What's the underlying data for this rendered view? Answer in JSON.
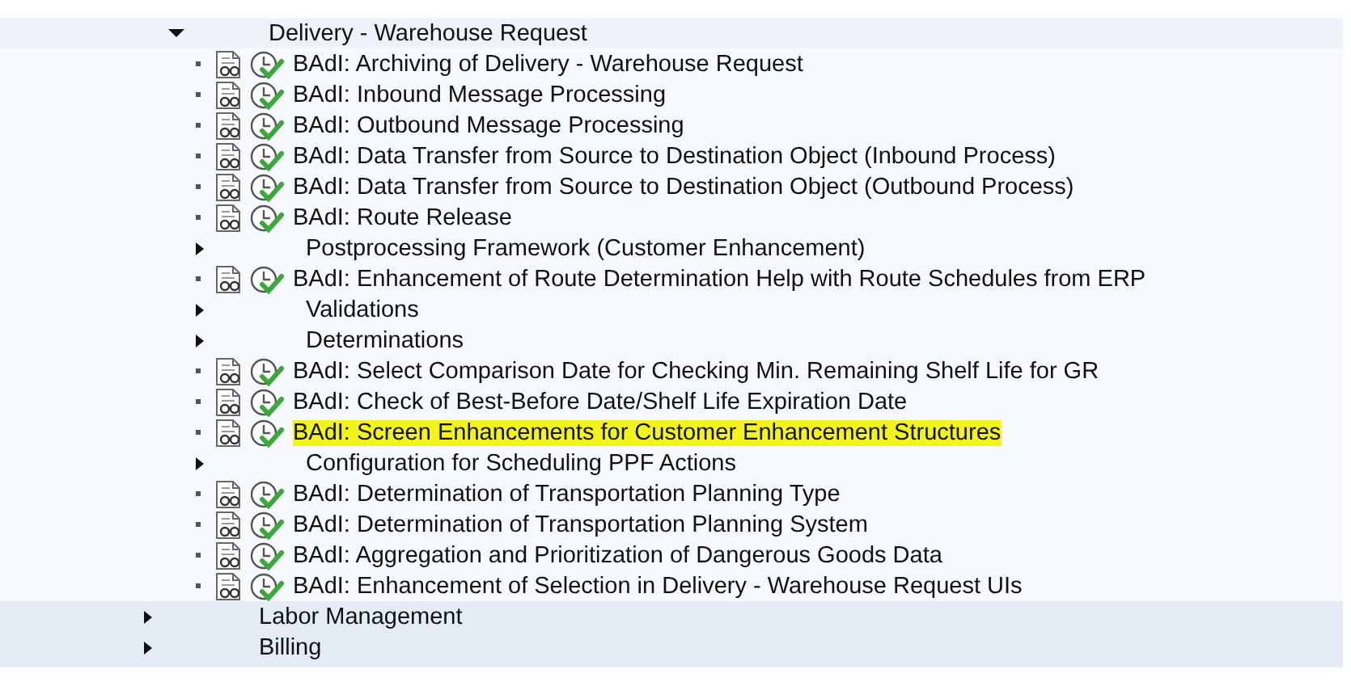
{
  "tree": {
    "expanded_node": {
      "label": "Delivery - Warehouse Request",
      "expanded": true,
      "children": [
        {
          "kind": "badi",
          "label": "BAdI: Archiving of Delivery - Warehouse Request",
          "highlighted": false
        },
        {
          "kind": "badi",
          "label": "BAdI: Inbound Message Processing",
          "highlighted": false
        },
        {
          "kind": "badi",
          "label": "BAdI: Outbound Message Processing",
          "highlighted": false
        },
        {
          "kind": "badi",
          "label": "BAdI: Data Transfer from Source to Destination Object (Inbound Process)",
          "highlighted": false
        },
        {
          "kind": "badi",
          "label": "BAdI: Data Transfer from Source to Destination Object (Outbound Process)",
          "highlighted": false
        },
        {
          "kind": "badi",
          "label": "BAdI: Route Release",
          "highlighted": false
        },
        {
          "kind": "folder",
          "label": "Postprocessing Framework (Customer Enhancement)",
          "expanded": false
        },
        {
          "kind": "badi",
          "label": "BAdI: Enhancement of Route Determination Help with Route Schedules from ERP",
          "highlighted": false
        },
        {
          "kind": "folder",
          "label": "Validations",
          "expanded": false
        },
        {
          "kind": "folder",
          "label": "Determinations",
          "expanded": false
        },
        {
          "kind": "badi",
          "label": "BAdI: Select Comparison Date for Checking Min. Remaining Shelf Life for GR",
          "highlighted": false
        },
        {
          "kind": "badi",
          "label": "BAdI: Check of Best-Before Date/Shelf Life Expiration Date",
          "highlighted": false
        },
        {
          "kind": "badi",
          "label": "BAdI: Screen Enhancements for Customer Enhancement Structures",
          "highlighted": true
        },
        {
          "kind": "folder",
          "label": "Configuration for Scheduling PPF Actions",
          "expanded": false
        },
        {
          "kind": "badi",
          "label": "BAdI: Determination of Transportation Planning Type",
          "highlighted": false
        },
        {
          "kind": "badi",
          "label": "BAdI: Determination of Transportation Planning System",
          "highlighted": false
        },
        {
          "kind": "badi",
          "label": "BAdI: Aggregation and Prioritization of Dangerous Goods Data",
          "highlighted": false
        },
        {
          "kind": "badi",
          "label": "BAdI: Enhancement of Selection in Delivery - Warehouse Request UIs",
          "highlighted": false
        }
      ]
    },
    "collapsed_nodes": [
      {
        "label": "Labor Management",
        "expanded": false
      },
      {
        "label": "Billing",
        "expanded": false
      }
    ]
  }
}
